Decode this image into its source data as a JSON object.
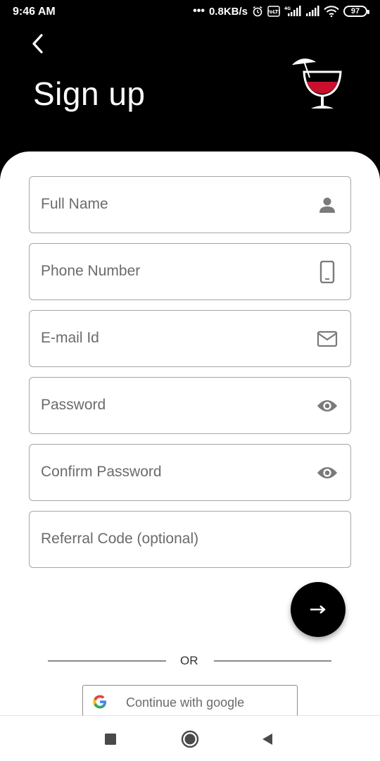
{
  "status_bar": {
    "time": "9:46 AM",
    "network_speed": "0.8KB/s",
    "battery_level": "97",
    "icons": [
      "alarm-icon",
      "volte-icon",
      "signal-4g-icon",
      "signal-icon",
      "wifi-icon",
      "battery-icon"
    ]
  },
  "header": {
    "title": "Sign up",
    "back_icon": "chevron-left-icon",
    "logo_icon": "cocktail-glass-logo"
  },
  "form": {
    "fields": [
      {
        "placeholder": "Full Name",
        "icon": "person-icon"
      },
      {
        "placeholder": "Phone Number",
        "icon": "phone-icon"
      },
      {
        "placeholder": "E-mail Id",
        "icon": "mail-icon"
      },
      {
        "placeholder": "Password",
        "icon": "eye-icon"
      },
      {
        "placeholder": "Confirm Password",
        "icon": "eye-icon"
      },
      {
        "placeholder": "Referral Code (optional)",
        "icon": ""
      }
    ],
    "next_icon": "arrow-right-icon"
  },
  "divider": {
    "label": "OR"
  },
  "social": {
    "google_label": "Continue with google",
    "google_icon": "google-g-icon"
  },
  "navigation": {
    "icons": [
      "recents-square-icon",
      "home-circle-icon",
      "back-triangle-icon"
    ]
  },
  "colors": {
    "header_bg": "#000000",
    "sheet_bg": "#ffffff",
    "field_border": "#a6a6a6",
    "placeholder_text": "#6b6b6b",
    "icon_gray": "#7a7a7a",
    "wine_red": "#c8102e"
  }
}
